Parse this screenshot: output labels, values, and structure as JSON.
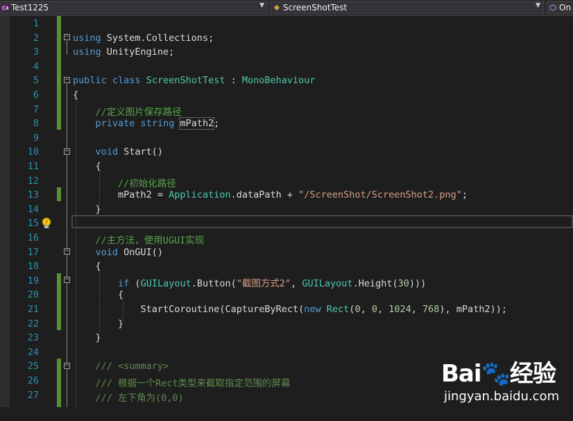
{
  "navbar": {
    "project": "Test1225",
    "class_name": "ScreenShotTest",
    "member": "On"
  },
  "lines": [
    {
      "n": "1",
      "html": ""
    },
    {
      "n": "2",
      "html": "<span class=\"kw\">using</span> System.Collections;"
    },
    {
      "n": "3",
      "html": "<span class=\"kw\">using</span> UnityEngine;"
    },
    {
      "n": "4",
      "html": ""
    },
    {
      "n": "5",
      "html": "<span class=\"kw\">public</span> <span class=\"kw\">class</span> <span class=\"ty\">ScreenShotTest</span> : <span class=\"ty\">MonoBehaviour</span>"
    },
    {
      "n": "6",
      "html": "{"
    },
    {
      "n": "7",
      "html": "    <span class=\"cm\">//定义图片保存路径</span>"
    },
    {
      "n": "8",
      "html": "    <span class=\"kw\">private</span> <span class=\"kw\">string</span> <span class=\"dotted\">mPath2</span>;"
    },
    {
      "n": "9",
      "html": ""
    },
    {
      "n": "10",
      "html": "    <span class=\"kw\">void</span> Start()"
    },
    {
      "n": "11",
      "html": "    {"
    },
    {
      "n": "12",
      "html": "        <span class=\"cm\">//初始化路径</span>"
    },
    {
      "n": "13",
      "html": "        mPath2 = <span class=\"ty\">Application</span>.dataPath + <span class=\"st\">\"/ScreenShot/ScreenShot2.png\"</span>;"
    },
    {
      "n": "14",
      "html": "    }"
    },
    {
      "n": "15",
      "html": ""
    },
    {
      "n": "16",
      "html": "    <span class=\"cm\">//主方法，使用UGUI实现</span>"
    },
    {
      "n": "17",
      "html": "    <span class=\"kw\">void</span> OnGUI()"
    },
    {
      "n": "18",
      "html": "    {"
    },
    {
      "n": "19",
      "html": "        <span class=\"kw\">if</span> (<span class=\"ty\">GUILayout</span>.Button(<span class=\"st\">\"截图方式2\"</span>, <span class=\"ty\">GUILayout</span>.Height(<span class=\"num\">30</span>)))"
    },
    {
      "n": "20",
      "html": "        {"
    },
    {
      "n": "21",
      "html": "            StartCoroutine(CaptureByRect(<span class=\"kw\">new</span> <span class=\"ty\">Rect</span>(<span class=\"num\">0</span>, <span class=\"num\">0</span>, <span class=\"num\">1024</span>, <span class=\"num\">768</span>), mPath2));"
    },
    {
      "n": "22",
      "html": "        }"
    },
    {
      "n": "23",
      "html": "    }"
    },
    {
      "n": "24",
      "html": ""
    },
    {
      "n": "25",
      "html": "    <span class=\"doc\">/// &lt;summary&gt;</span>"
    },
    {
      "n": "26",
      "html": "    <span class=\"doc\">/// 根据一个Rect类型来截取指定范围的屏幕</span>"
    },
    {
      "n": "27",
      "html": "    <span class=\"doc\">/// 左下角为(0,0)</span>"
    }
  ],
  "watermark": {
    "logo": "Bai🐾经验",
    "url": "jingyan.baidu.com"
  },
  "colors": {
    "background": "#1e1e1e",
    "line_number": "#2b91af",
    "keyword": "#569cd6",
    "type": "#4ec9b0",
    "comment": "#57a64a",
    "string": "#d69d85",
    "change_bar": "#5b8f34"
  }
}
